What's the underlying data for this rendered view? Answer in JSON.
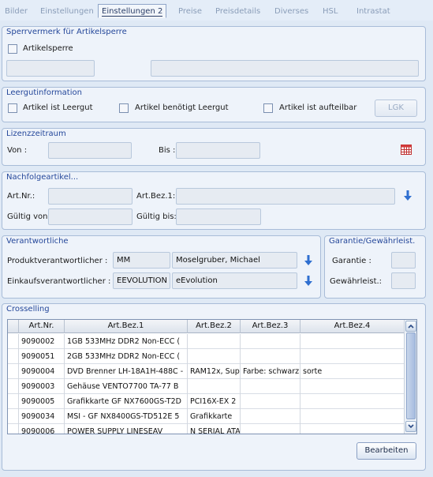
{
  "tabs": [
    {
      "label": "Bilder"
    },
    {
      "label": "Einstellungen"
    },
    {
      "label": "Einstellungen 2"
    },
    {
      "label": "Preise"
    },
    {
      "label": "Preisdetails"
    },
    {
      "label": "Diverses"
    },
    {
      "label": "HSL"
    },
    {
      "label": "Intrastat"
    }
  ],
  "active_tab": "Einstellungen 2",
  "sperrvermerk": {
    "title": "Sperrvermerk für Artikelsperre",
    "artikelsperre_label": "Artikelsperre",
    "artikelsperre_checked": false,
    "field1": "",
    "field2": ""
  },
  "leergut": {
    "title": "Leergutinformation",
    "cb1": "Artikel ist Leergut",
    "cb2": "Artikel benötigt Leergut",
    "cb3": "Artikel ist aufteilbar",
    "lgk_button": "LGK"
  },
  "lizenz": {
    "title": "Lizenzzeitraum",
    "von_label": "Von :",
    "von": "",
    "bis_label": "Bis :",
    "bis": ""
  },
  "nachfolge": {
    "title": "Nachfolgeartikel...",
    "artnr_label": "Art.Nr.:",
    "artnr": "",
    "artbez_label": "Art.Bez.1:",
    "artbez": "",
    "gueltig_von_label": "Gültig von:",
    "gueltig_von": "",
    "gueltig_bis_label": "Gültig bis:",
    "gueltig_bis": ""
  },
  "verantwortliche": {
    "title": "Verantwortliche",
    "produkt_label": "Produktverantwortlicher :",
    "produkt_code": "MM",
    "produkt_name": "Moselgruber, Michael",
    "einkauf_label": "Einkaufsverantwortlicher :",
    "einkauf_code": "EEVOLUTION",
    "einkauf_name": "eEvolution"
  },
  "garantie": {
    "title": "Garantie/Gewährleist.",
    "garantie_label": "Garantie :",
    "garantie": "",
    "gewaehr_label": "Gewährleist.:",
    "gewaehr": ""
  },
  "crosselling": {
    "title": "Crosselling",
    "columns": [
      "Art.Nr.",
      "Art.Bez.1",
      "Art.Bez.2",
      "Art.Bez.3",
      "Art.Bez.4"
    ],
    "rows": [
      [
        "9090002",
        "1GB 533MHz DDR2 Non-ECC (",
        "",
        "",
        ""
      ],
      [
        "9090051",
        "2GB 533MHz DDR2 Non-ECC (",
        "",
        "",
        ""
      ],
      [
        "9090004",
        "DVD Brenner LH-18A1H-488C -",
        "RAM12x, Sup",
        "Farbe: schwarz",
        "sorte"
      ],
      [
        "9090003",
        "Gehäuse VENTO7700 TA-77 B",
        "",
        "",
        ""
      ],
      [
        "9090005",
        "Grafikkarte GF NX7600GS-T2D",
        "PCI16X-EX 2",
        "",
        ""
      ],
      [
        "9090034",
        "MSI - GF NX8400GS-TD512E 5",
        "Grafikkarte",
        "",
        ""
      ],
      [
        "9090006",
        "POWER SUPPLY LINESEAV",
        "N SERIAL ATA",
        "",
        ""
      ]
    ],
    "edit_button": "Bearbeiten"
  },
  "colors": {
    "accent": "#24479a",
    "arrow": "#2f6fd0",
    "background": "#dfe9f5"
  },
  "icons": {
    "calendar": "calendar-icon",
    "arrow": "arrow-down-icon"
  }
}
